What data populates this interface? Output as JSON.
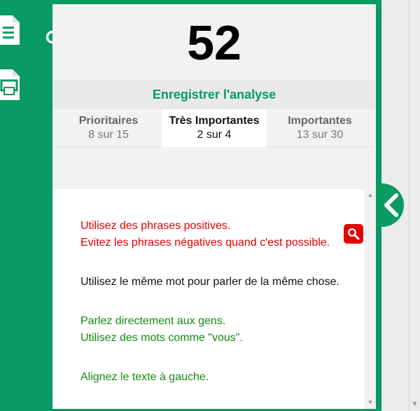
{
  "score": "52",
  "save_label": "Enregistrer l'analyse",
  "tabs": [
    {
      "label": "Prioritaires",
      "count": "8 sur 15",
      "active": false
    },
    {
      "label": "Très Importantes",
      "count": "2 sur 4",
      "active": true
    },
    {
      "label": "Importantes",
      "count": "13 sur 30",
      "active": false
    }
  ],
  "recommendations": [
    {
      "lines": [
        "Utilisez des phrases positives.",
        "Evitez les phrases négatives quand c'est possible."
      ],
      "color": "#e00000"
    },
    {
      "lines": [
        "Utilisez le même mot pour parler de la même chose."
      ],
      "color": "#111111"
    },
    {
      "lines": [
        "Parlez directement aux gens.",
        "Utilisez des mots comme \"vous\"."
      ],
      "color": "#118a11"
    },
    {
      "lines": [
        "Alignez le texte à gauche."
      ],
      "color": "#118a11"
    }
  ],
  "icons": {
    "sidebar": [
      "document-icon",
      "print-icon",
      "search-icon"
    ],
    "highlight": "search-icon",
    "collapse": "chevron-left-icon"
  },
  "colors": {
    "brand_green": "#0a9a63",
    "highlight_red": "#e40000"
  }
}
